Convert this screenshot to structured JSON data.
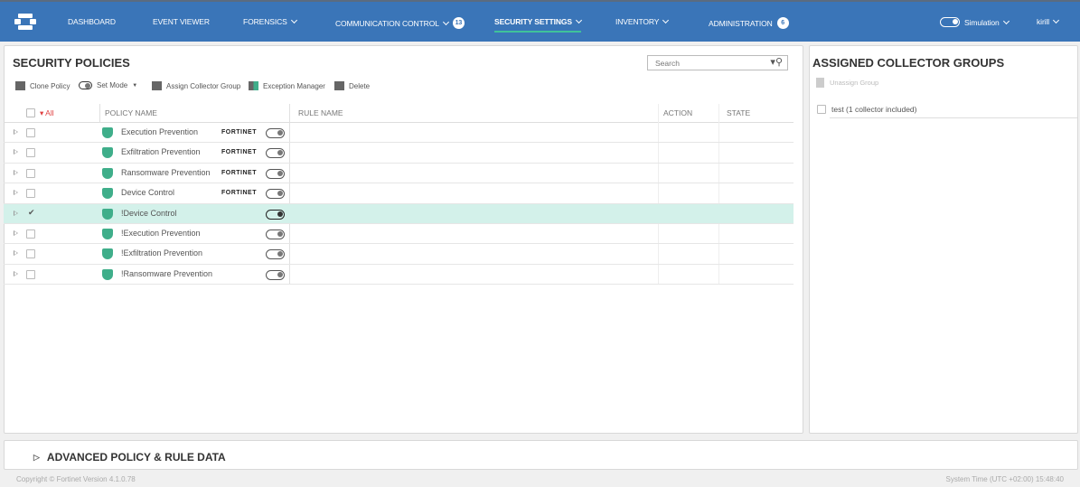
{
  "nav": {
    "items": [
      {
        "label": "DASHBOARD"
      },
      {
        "label": "EVENT VIEWER"
      },
      {
        "label": "FORENSICS",
        "dropdown": true
      },
      {
        "label": "COMMUNICATION CONTROL",
        "dropdown": true,
        "badge": "13"
      },
      {
        "label": "SECURITY SETTINGS",
        "dropdown": true,
        "active": true
      },
      {
        "label": "INVENTORY",
        "dropdown": true
      },
      {
        "label": "ADMINISTRATION",
        "badge": "6"
      }
    ],
    "simulation": "Simulation",
    "user": "kirill"
  },
  "policies": {
    "title": "SECURITY POLICIES",
    "toolbar": {
      "clone": "Clone Policy",
      "set_mode": "Set Mode",
      "assign": "Assign Collector Group",
      "exception": "Exception Manager",
      "delete": "Delete"
    },
    "search_placeholder": "Search",
    "columns": {
      "all": "All",
      "policy": "POLICY NAME",
      "rule": "RULE NAME",
      "action": "ACTION",
      "state": "STATE"
    },
    "rows": [
      {
        "name": "Execution Prevention",
        "vendor": "FORTINET",
        "icon": "shield-icon"
      },
      {
        "name": "Exfiltration Prevention",
        "vendor": "FORTINET",
        "icon": "exfiltration-icon"
      },
      {
        "name": "Ransomware Prevention",
        "vendor": "FORTINET",
        "icon": "lock-icon"
      },
      {
        "name": "Device Control",
        "vendor": "FORTINET",
        "icon": "usb-icon"
      },
      {
        "name": "!Device Control",
        "vendor": "",
        "icon": "usb-icon",
        "selected": true
      },
      {
        "name": "!Execution Prevention",
        "vendor": "",
        "icon": "shield-icon"
      },
      {
        "name": "!Exfiltration Prevention",
        "vendor": "",
        "icon": "exfiltration-icon"
      },
      {
        "name": "!Ransomware Prevention",
        "vendor": "",
        "icon": "lock-icon"
      }
    ]
  },
  "groups": {
    "title": "ASSIGNED COLLECTOR GROUPS",
    "unassign": "Unassign Group",
    "items": [
      "test (1 collector included)"
    ]
  },
  "advanced": {
    "title": "ADVANCED POLICY & RULE DATA"
  },
  "footer": {
    "copyright": "Copyright © Fortinet Version 4.1.0.78",
    "time": "System Time (UTC +02:00) 15:48:40"
  },
  "colors": {
    "nav": "#3a75b8",
    "accent": "#3fc29a",
    "selected_row": "#d3f1ea",
    "icon": "#3fae8a"
  }
}
